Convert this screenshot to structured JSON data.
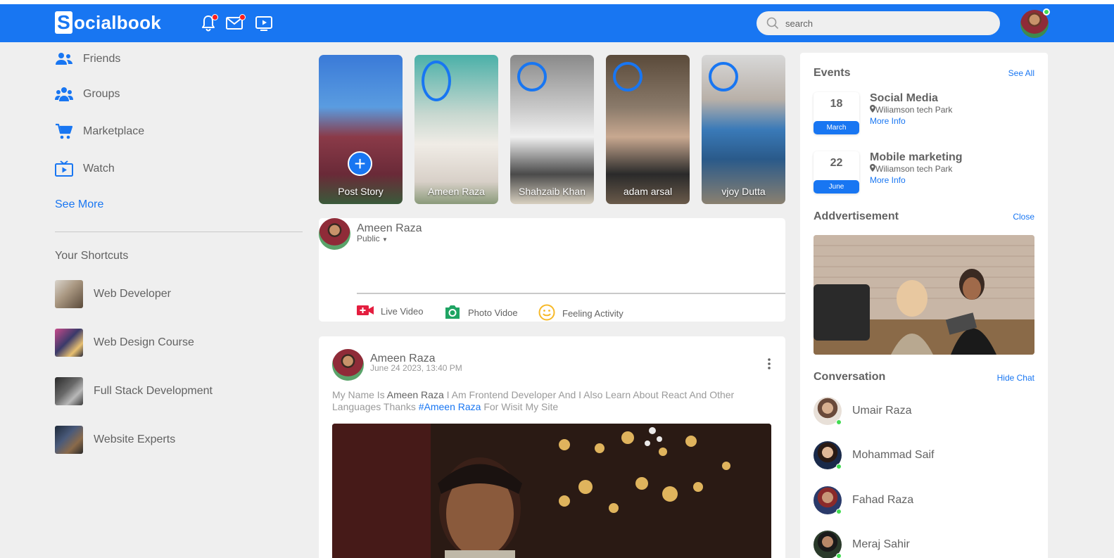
{
  "app": {
    "logo_letter": "S",
    "logo_rest": "ocialbook"
  },
  "nav": {
    "icons": [
      "notification-icon",
      "inbox-icon",
      "video-icon"
    ],
    "search_placeholder": "search"
  },
  "left_menu": {
    "items": [
      {
        "label": "Friends",
        "icon": "friends-icon"
      },
      {
        "label": "Groups",
        "icon": "groups-icon"
      },
      {
        "label": "Marketplace",
        "icon": "marketplace-icon"
      },
      {
        "label": "Watch",
        "icon": "watch-icon"
      }
    ],
    "see_more": "See More",
    "shortcuts_title": "Your Shortcuts",
    "shortcuts": [
      {
        "label": "Web Developer"
      },
      {
        "label": "Web Design Course"
      },
      {
        "label": "Full Stack Development"
      },
      {
        "label": "Website Experts"
      }
    ]
  },
  "stories": [
    {
      "label": "Post Story"
    },
    {
      "label": "Ameen Raza"
    },
    {
      "label": "Shahzaib Khan"
    },
    {
      "label": "adam arsal"
    },
    {
      "label": "vjoy Dutta"
    }
  ],
  "write_post": {
    "name": "Ameen Raza",
    "privacy": "Public",
    "actions": [
      {
        "label": "Live Video",
        "icon": "live-video-icon",
        "color": "#e41e3f"
      },
      {
        "label": "Photo Vidoe",
        "icon": "photo-icon",
        "color": "#1fa463"
      },
      {
        "label": "Feeling Activity",
        "icon": "feeling-icon",
        "color": "#f7b928"
      }
    ]
  },
  "post": {
    "name": "Ameen Raza",
    "date": "June 24 2023, 13:40 PM",
    "text_before": "My Name Is ",
    "text_name": "Ameen Raza",
    "text_mid": " I Am Frontend Developer And I Also Learn About React And Other Languages Thanks ",
    "text_tag": "#Ameen Raza",
    "text_after": " For Wisit My Site"
  },
  "sidebar": {
    "events_title": "Events",
    "see_all": "See All",
    "events": [
      {
        "day": "18",
        "month": "March",
        "title": "Social Media",
        "place": "Wiliamson tech Park",
        "more": "More Info"
      },
      {
        "day": "22",
        "month": "June",
        "title": "Mobile marketing",
        "place": "Wiliamson tech Park",
        "more": "More Info"
      }
    ],
    "ad_title": "Addvertisement",
    "ad_close": "Close",
    "conv_title": "Conversation",
    "hide_chat": "Hide Chat",
    "contacts": [
      {
        "name": "Umair Raza"
      },
      {
        "name": "Mohammad Saif"
      },
      {
        "name": "Fahad Raza"
      },
      {
        "name": "Meraj Sahir"
      }
    ]
  },
  "colors": {
    "brand": "#1876f2",
    "online": "#41db51",
    "badge": "#ff1d1d"
  }
}
